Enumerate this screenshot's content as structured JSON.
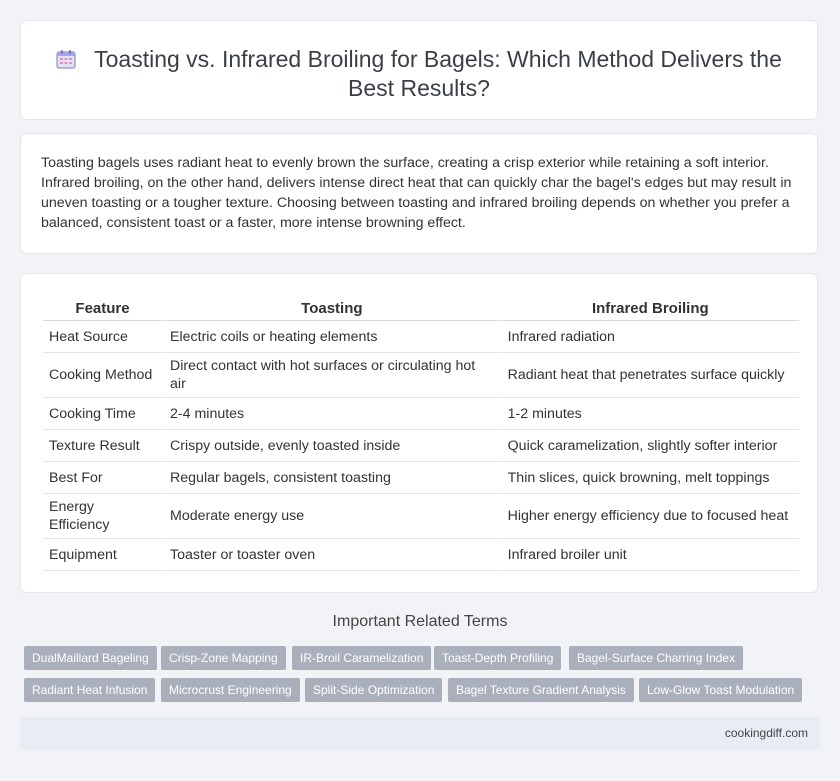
{
  "header": {
    "icon": "calendar-icon",
    "title": "Toasting vs. Infrared Broiling for Bagels: Which Method Delivers the Best Results?"
  },
  "intro": {
    "text": "Toasting bagels uses radiant heat to evenly brown the surface, creating a crisp exterior while retaining a soft interior. Infrared broiling, on the other hand, delivers intense direct heat that can quickly char the bagel's edges but may result in uneven toasting or a tougher texture. Choosing between toasting and infrared broiling depends on whether you prefer a balanced, consistent toast or a faster, more intense browning effect."
  },
  "table": {
    "headers": [
      "Feature",
      "Toasting",
      "Infrared Broiling"
    ],
    "rows": [
      [
        "Heat Source",
        "Electric coils or heating elements",
        "Infrared radiation"
      ],
      [
        "Cooking Method",
        "Direct contact with hot surfaces or circulating hot air",
        "Radiant heat that penetrates surface quickly"
      ],
      [
        "Cooking Time",
        "2-4 minutes",
        "1-2 minutes"
      ],
      [
        "Texture Result",
        "Crispy outside, evenly toasted inside",
        "Quick caramelization, slightly softer interior"
      ],
      [
        "Best For",
        "Regular bagels, consistent toasting",
        "Thin slices, quick browning, melt toppings"
      ],
      [
        "Energy Efficiency",
        "Moderate energy use",
        "Higher energy efficiency due to focused heat"
      ],
      [
        "Equipment",
        "Toaster or toaster oven",
        "Infrared broiler unit"
      ]
    ]
  },
  "terms": {
    "title": "Important Related Terms",
    "items": [
      "DualMaillard Bageling",
      "Crisp-Zone Mapping",
      "IR-Broil Caramelization",
      "Toast-Depth Profiling",
      "Bagel-Surface Charring Index",
      "Radiant Heat Infusion",
      "Microcrust Engineering",
      "Split-Side Optimization",
      "Bagel Texture Gradient Analysis",
      "Low-Glow Toast Modulation"
    ]
  },
  "footer": {
    "site": "cookingdiff.com"
  }
}
